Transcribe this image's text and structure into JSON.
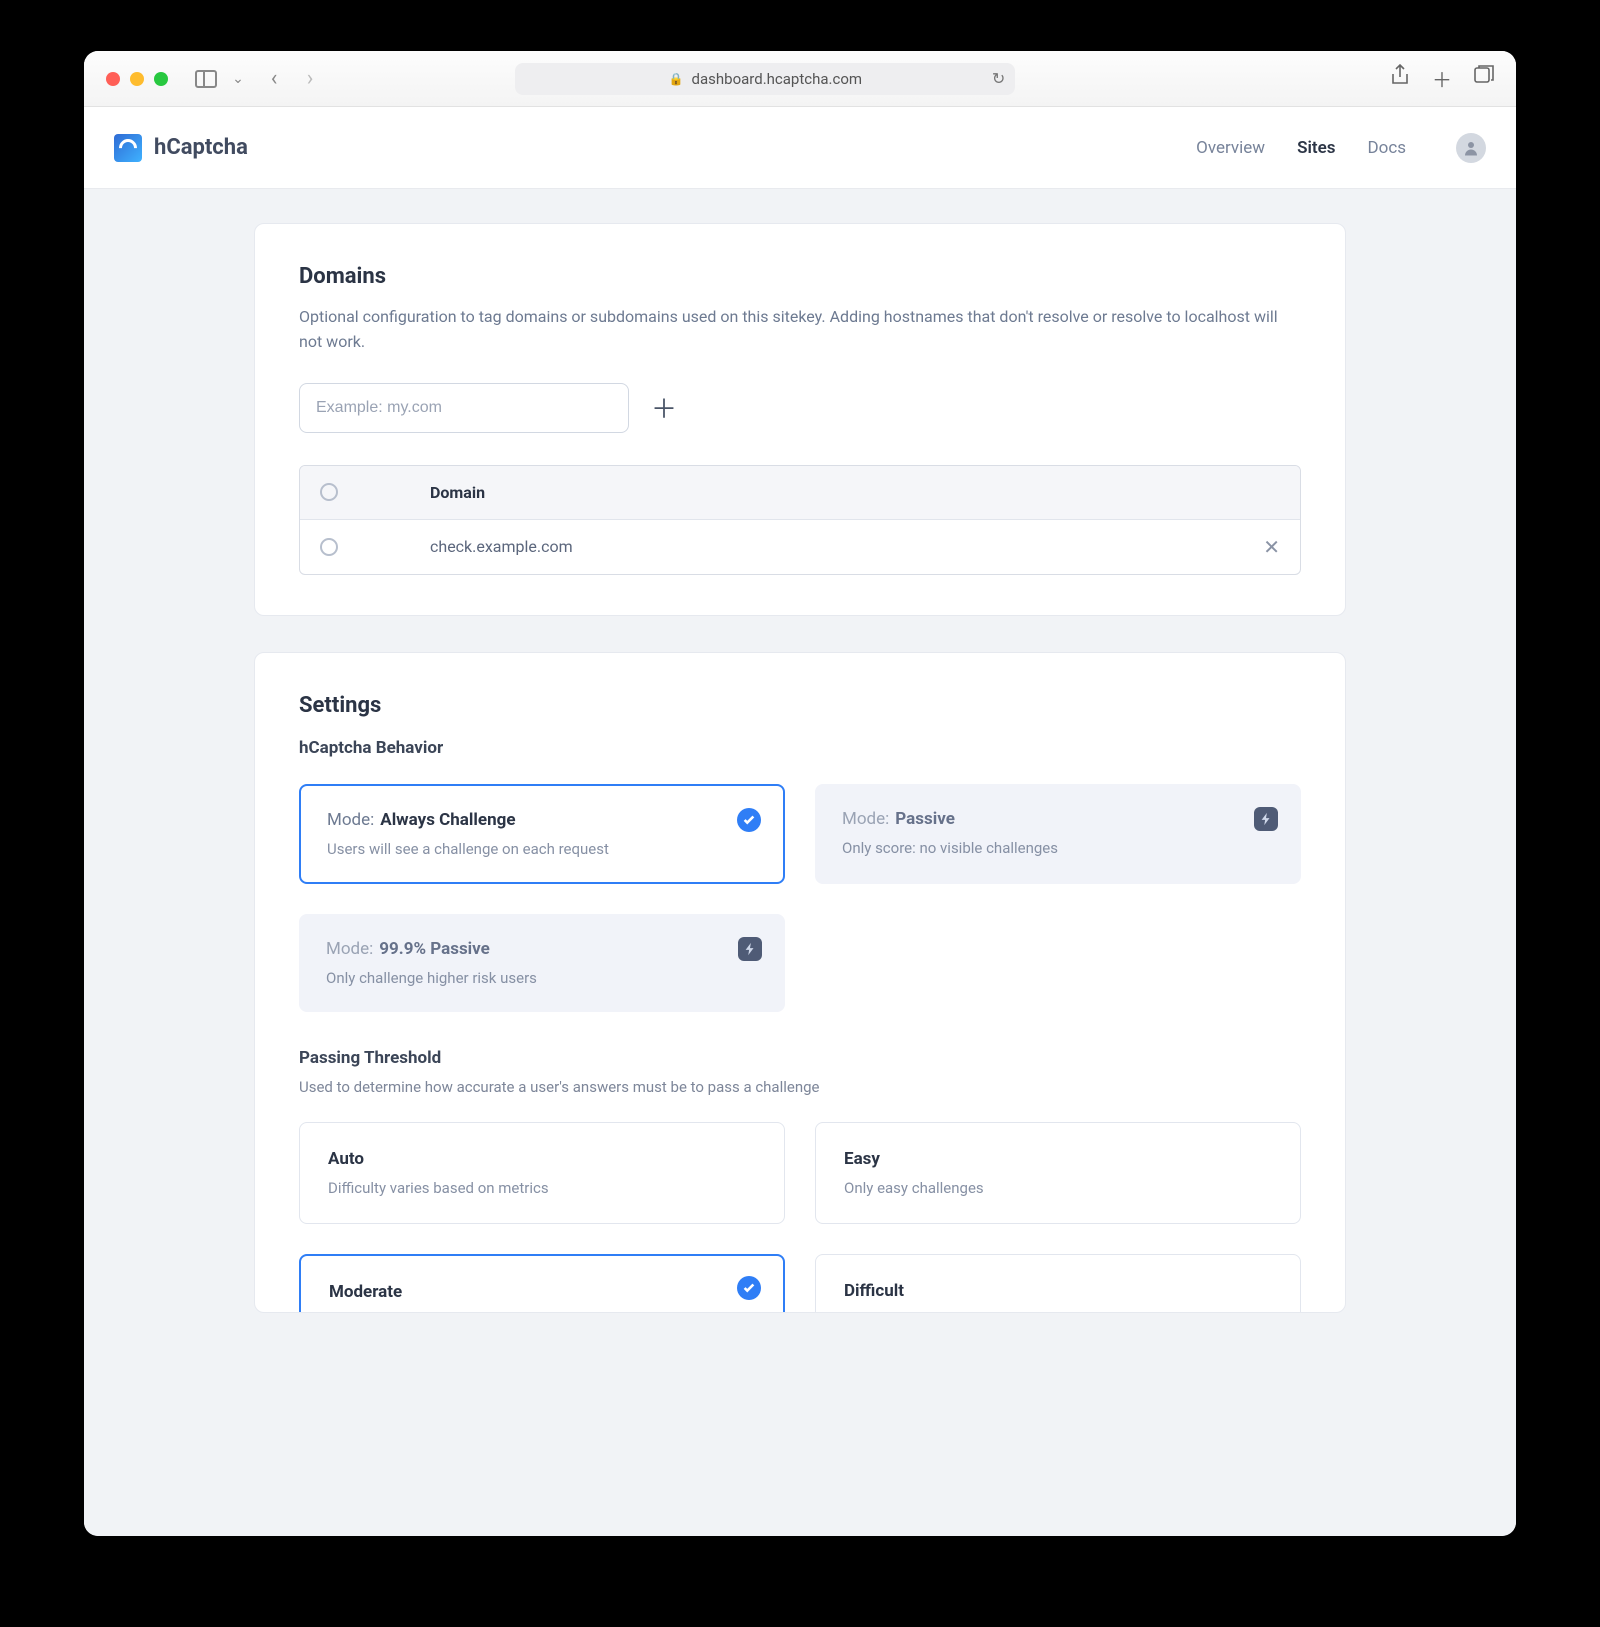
{
  "browser": {
    "url": "dashboard.hcaptcha.com"
  },
  "brand": {
    "name": "hCaptcha"
  },
  "nav": {
    "overview": "Overview",
    "sites": "Sites",
    "docs": "Docs"
  },
  "domains": {
    "title": "Domains",
    "description": "Optional configuration to tag domains or subdomains used on this sitekey. Adding hostnames that don't resolve or resolve to localhost will not work.",
    "input_placeholder": "Example: my.com",
    "header_label": "Domain",
    "rows": [
      {
        "value": "check.example.com"
      }
    ]
  },
  "settings": {
    "title": "Settings",
    "behavior_label": "hCaptcha Behavior",
    "mode_prefix": "Mode:",
    "modes": [
      {
        "name": "Always Challenge",
        "desc": "Users will see a challenge on each request",
        "selected": true,
        "premium": false
      },
      {
        "name": "Passive",
        "desc": "Only score: no visible challenges",
        "selected": false,
        "premium": true
      },
      {
        "name": "99.9% Passive",
        "desc": "Only challenge higher risk users",
        "selected": false,
        "premium": true
      }
    ],
    "threshold_title": "Passing Threshold",
    "threshold_sub": "Used to determine how accurate a user's answers must be to pass a challenge",
    "thresholds": [
      {
        "name": "Auto",
        "desc": "Difficulty varies based on metrics",
        "selected": false
      },
      {
        "name": "Easy",
        "desc": "Only easy challenges",
        "selected": false
      },
      {
        "name": "Moderate",
        "desc": "",
        "selected": true
      },
      {
        "name": "Difficult",
        "desc": "",
        "selected": false
      }
    ]
  }
}
